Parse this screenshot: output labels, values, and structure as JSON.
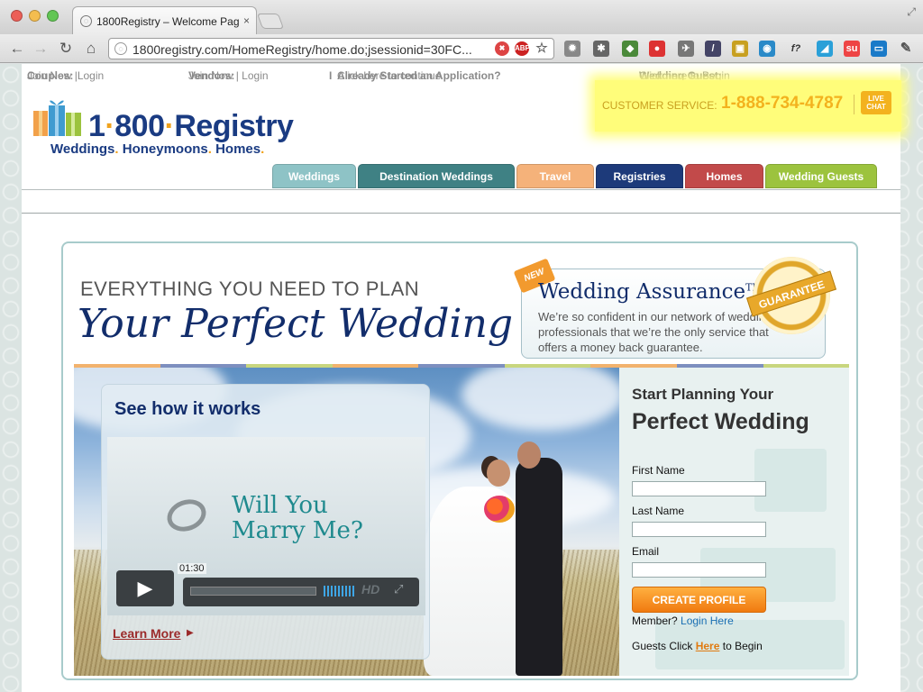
{
  "browser": {
    "tab_title": "1800Registry – Welcome Pag",
    "tab_close": "×",
    "url": "1800registry.com/HomeRegistry/home.do;jsessionid=30FC...",
    "omnibox_icons": [
      "abp-icon",
      "block-icon",
      "star-icon"
    ],
    "abp_label": "ABP"
  },
  "topbar": {
    "couples_label": "Couples:",
    "couples_join": "Join Now",
    "couples_sep": "|",
    "couples_login": "Login",
    "vendors_label": "Vendors:",
    "vendors_join": "Join Now",
    "vendors_sep": "|",
    "vendors_login": "Login",
    "sep": "I",
    "application_label": "Already Started an Application?",
    "application_link": "Click here to continue",
    "guest_label": "Wedding Guest:",
    "guest_link": "Click here to Begin"
  },
  "logo": {
    "one": "1",
    "dot1": "·",
    "eight": "800",
    "dot2": "·",
    "registry": "Registry",
    "tag_weddings": "Weddings",
    "tag_honeymoons": "Honeymoons",
    "tag_homes": "Homes",
    "tag_dot": "."
  },
  "customer_service": {
    "label": "CUSTOMER SERVICE:",
    "phone": "1-888-734-4787",
    "live": "LIVE",
    "chat": "CHAT"
  },
  "nav": [
    {
      "label": "Weddings",
      "color": "#8ec3c6"
    },
    {
      "label": "Destination Weddings",
      "color": "#3f8184"
    },
    {
      "label": "Travel",
      "color": "#f5b27a"
    },
    {
      "label": "Registries",
      "color": "#1d3a7a"
    },
    {
      "label": "Homes",
      "color": "#c24a4a"
    },
    {
      "label": "Wedding Guests",
      "color": "#9cc33e"
    }
  ],
  "hero": {
    "everything": "EVERYTHING YOU NEED TO PLAN",
    "perfect": "Your Perfect Wedding",
    "stripe_colors": [
      "#f2b26d",
      "#7d8fbf",
      "#c8d67e",
      "#f2b26d",
      "#7d8fbf",
      "#c8d67e",
      "#f2b26d",
      "#7d8fbf",
      "#c8d67e"
    ]
  },
  "assurance": {
    "new": "NEW",
    "title": "Wedding Assurance",
    "tm": "TM",
    "body": "We’re so confident in our network of wedding professionals that we’re the only service that offers a money back guarantee.",
    "seal": "GUARANTEE"
  },
  "video": {
    "heading": "See how it works",
    "line1": "Will You",
    "line2": "Marry Me?",
    "time": "01:30",
    "hd": "HD",
    "play": "▶",
    "fullscreen": "⤢",
    "learn_more": "Learn More",
    "learn_arrow": "▶"
  },
  "form": {
    "start": "Start Planning Your",
    "perfect": "Perfect Wedding",
    "first_name_label": "First Name",
    "first_name_value": "",
    "last_name_label": "Last Name",
    "last_name_value": "",
    "email_label": "Email",
    "email_value": "",
    "create": "CREATE PROFILE",
    "member_text": "Member?",
    "login_here": "Login Here",
    "guests_text": "Guests Click",
    "here": "Here",
    "to_begin": "to Begin"
  }
}
